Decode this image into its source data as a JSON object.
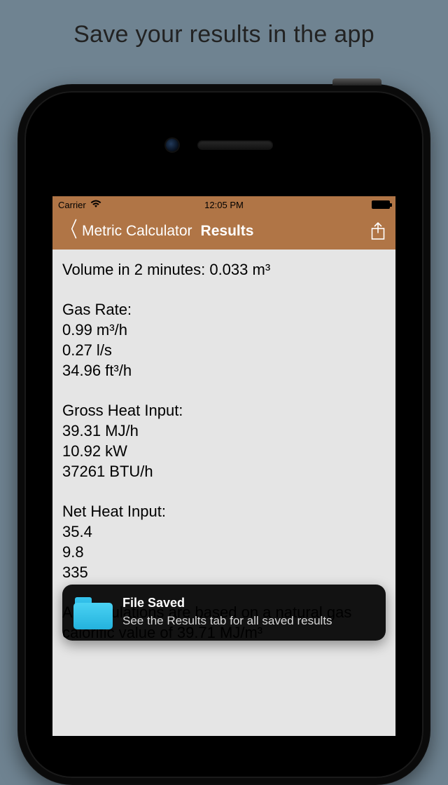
{
  "promo": {
    "title": "Save your results in the app"
  },
  "status": {
    "carrier": "Carrier",
    "time": "12:05 PM"
  },
  "nav": {
    "back_label": "Metric Calculator",
    "title": "Results"
  },
  "results": {
    "volume_line": "Volume in 2 minutes: 0.033 m³",
    "gas_rate": {
      "heading": "Gas Rate:",
      "l1": "0.99 m³/h",
      "l2": "0.27 l/s",
      "l3": "34.96 ft³/h"
    },
    "gross_heat": {
      "heading": "Gross Heat Input:",
      "l1": "39.31 MJ/h",
      "l2": "10.92 kW",
      "l3": "37261 BTU/h"
    },
    "net_heat": {
      "heading": "Net Heat Input:",
      "l1": "35.4",
      "l2": "9.8",
      "l3": "335"
    },
    "footer": "All calculations are based on a natural gas calorific value of 39.71 MJ/m³"
  },
  "toast": {
    "title": "File Saved",
    "body": "See the Results tab for all saved results"
  }
}
